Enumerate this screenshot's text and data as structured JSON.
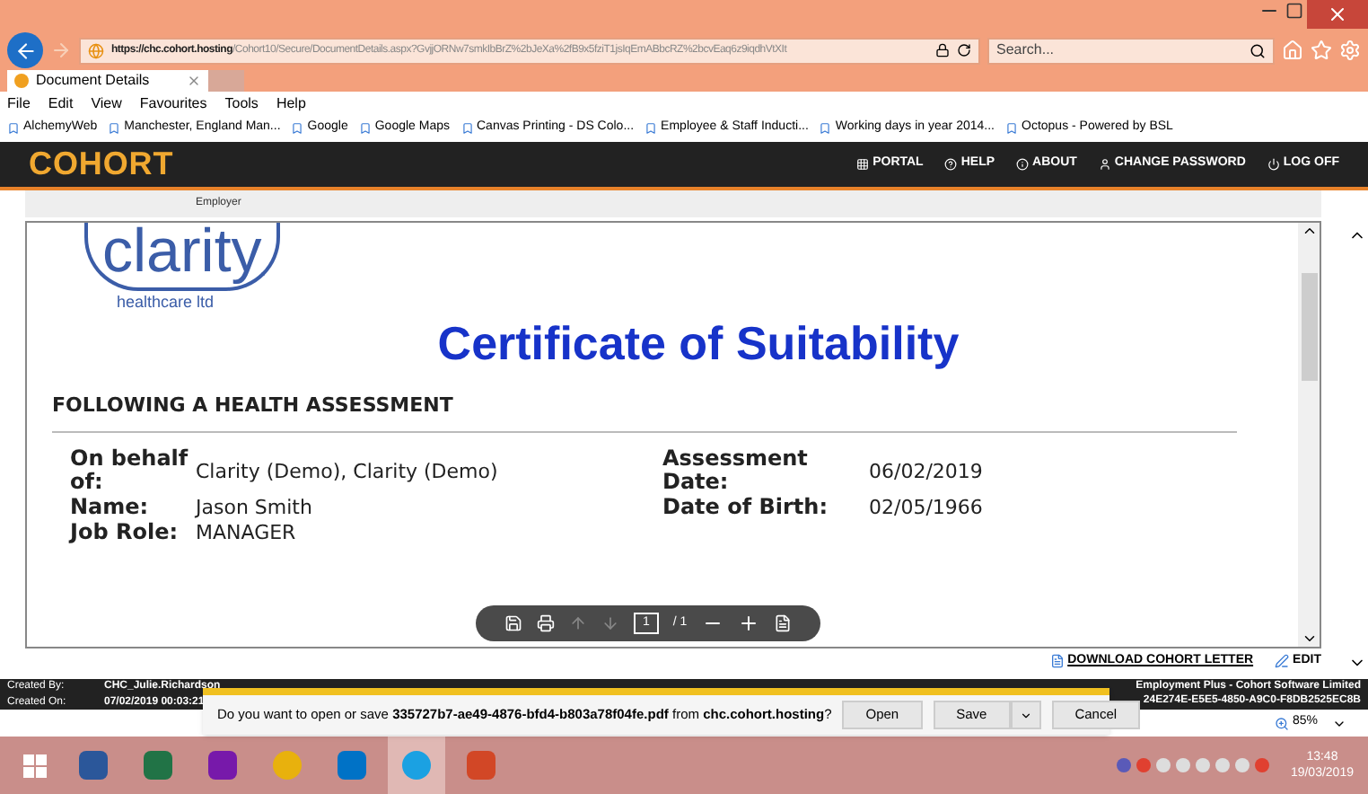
{
  "browser": {
    "url_host": "https://chc.cohort.hosting",
    "url_path": "/Cohort10/Secure/DocumentDetails.aspx?GvjjORNw7smkIbBrZ%2bJeXa%2fB9x5fziT1jsIqEmABbcRZ%2bcvEaq6z9iqdhVtXIt",
    "search_placeholder": "Search...",
    "tabs": [
      {
        "label": "Document Details",
        "selected": true
      }
    ],
    "menu": [
      "File",
      "Edit",
      "View",
      "Favourites",
      "Tools",
      "Help"
    ],
    "favourites": [
      "AlchemyWeb",
      "Manchester, England Man...",
      "Google",
      "Google Maps",
      "Canvas Printing - DS Colo...",
      "Employee & Staff Inducti...",
      "Working days in year 2014...",
      "Octopus - Powered by BSL"
    ]
  },
  "app": {
    "logo": "COHORT",
    "nav": [
      "PORTAL",
      "HELP",
      "ABOUT",
      "CHANGE PASSWORD",
      "LOG OFF"
    ],
    "breadcrumb": "Employer"
  },
  "document": {
    "logo_word": "clarity",
    "logo_sub": "healthcare ltd",
    "title": "Certificate of Suitability",
    "subtitle": "FOLLOWING A HEALTH ASSESSMENT",
    "fields": [
      {
        "label": "On behalf of:",
        "value": "Clarity (Demo), Clarity (Demo)"
      },
      {
        "label": "Assessment Date:",
        "value": "06/02/2019"
      },
      {
        "label": "Name:",
        "value": "Jason Smith"
      },
      {
        "label": "Date of Birth:",
        "value": "02/05/1966"
      },
      {
        "label": "Job Role:",
        "value": "MANAGER"
      }
    ],
    "toolbar_page": "1",
    "toolbar_total": "/ 1"
  },
  "actions": [
    "DOWNLOAD COHORT LETTER",
    "EDIT"
  ],
  "footer": {
    "created_by_label": "Created By:",
    "created_by": "CHC_Julie.Richardson",
    "created_on_label": "Created On:",
    "created_on": "07/02/2019 00:03:21",
    "company": "Employment Plus - Cohort Software Limited",
    "code": "24E274E-E5E5-4850-A9C0-F8DB2525EC8B"
  },
  "download_bar": {
    "prefix": "Do you want to open or save ",
    "file": "335727b7-ae49-4876-bfd4-b803a78f04fe.pdf",
    "middle": " from ",
    "host": "chc.cohort.hosting",
    "suffix": "?",
    "buttons": [
      "Open",
      "Save",
      "Cancel"
    ]
  },
  "zoom": "85%",
  "taskbar": {
    "apps": [
      {
        "kind": "word",
        "selected": false
      },
      {
        "kind": "excel",
        "selected": false
      },
      {
        "kind": "onenote",
        "selected": false
      },
      {
        "kind": "chrome",
        "selected": false
      },
      {
        "kind": "outlook",
        "selected": false
      },
      {
        "kind": "ie",
        "selected": true
      },
      {
        "kind": "powerpoint",
        "selected": false
      }
    ],
    "time": "13:48",
    "date": "19/03/2019"
  }
}
